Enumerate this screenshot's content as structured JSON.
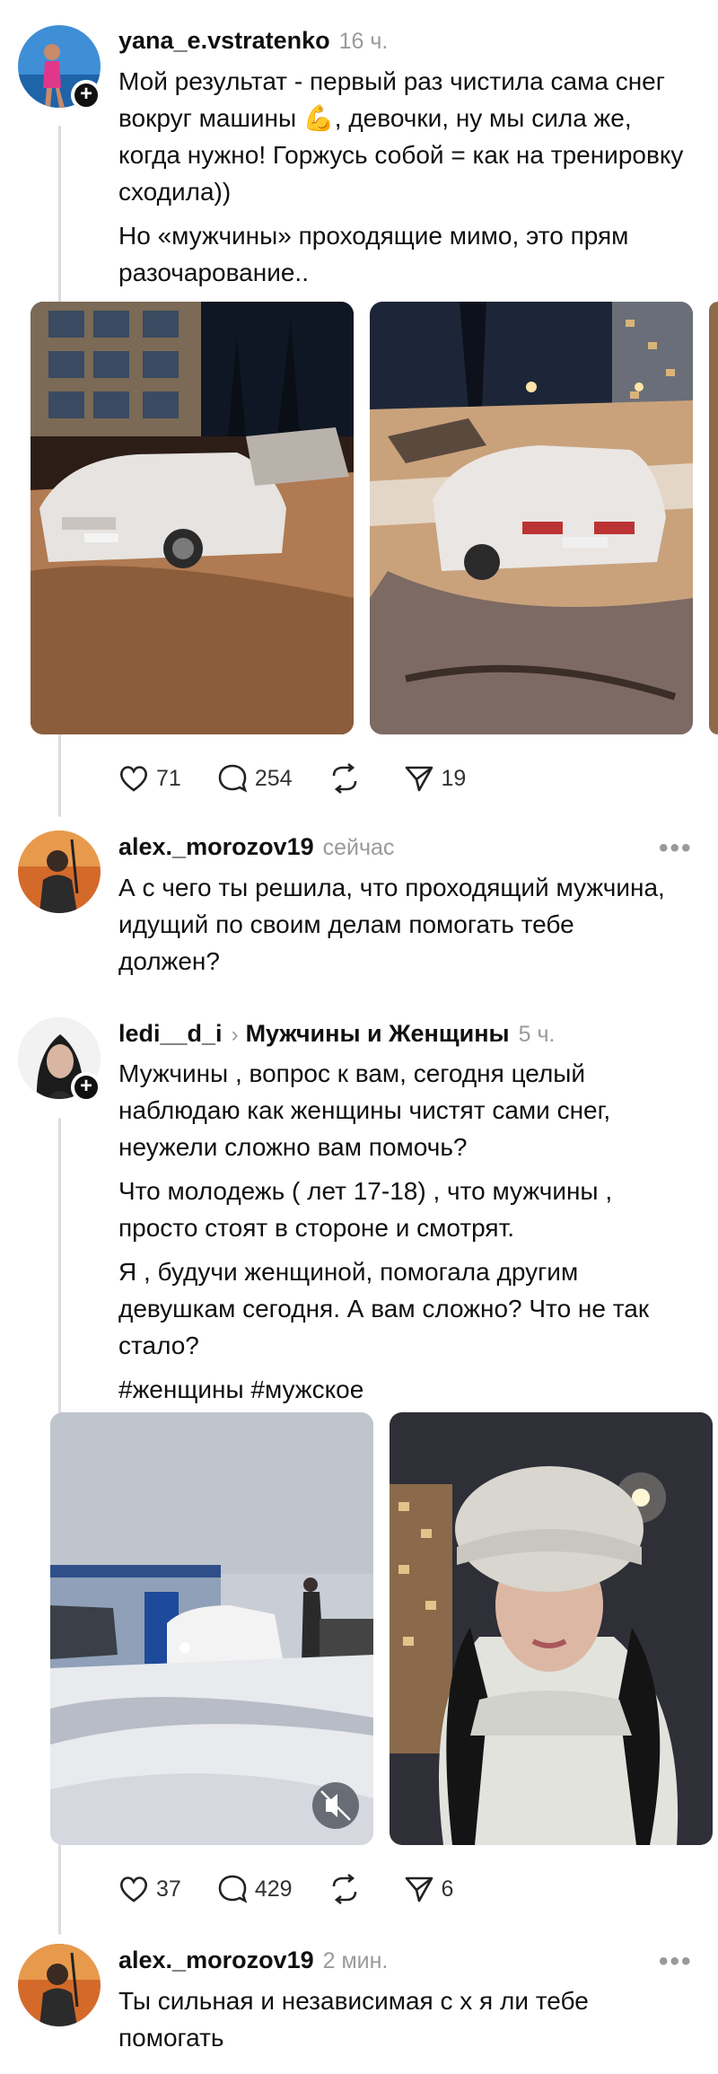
{
  "post1": {
    "username": "yana_e.vstratenko",
    "time": "16 ч.",
    "paragraphs": [
      "Мой результат - первый раз чистила сама снег вокруг машины 💪, девочки, ну мы сила же, когда нужно! Горжусь собой = как на тренировку сходила))",
      "Но «мужчины» проходящие мимо, это прям разочарование.."
    ],
    "likes": "71",
    "comments": "254",
    "shares": "19"
  },
  "reply1": {
    "username": "alex._morozov19",
    "time": "сейчас",
    "text": "А с чего ты решила, что проходящий мужчина, идущий по своим делам помогать тебе должен?"
  },
  "post2": {
    "username": "ledi__d_i",
    "community_arrow": "›",
    "community": "Мужчины и Женщины",
    "time": "5 ч.",
    "paragraphs": [
      "Мужчины , вопрос к вам, сегодня целый наблюдаю как женщины чистят сами снег, неужели сложно вам помочь?",
      "Что молодежь ( лет 17-18) , что мужчины , просто стоят в стороне и смотрят.",
      "Я , будучи женщиной, помогала другим девушкам сегодня. А вам сложно? Что не так стало?",
      "#женщины #мужское"
    ],
    "likes": "37",
    "comments": "429",
    "shares": "6"
  },
  "reply2": {
    "username": "alex._morozov19",
    "time": "2 мин.",
    "text": "Ты сильная и независимая с х  я ли тебе помогать"
  },
  "icons": {
    "plus": "+",
    "more": "•••"
  },
  "colors": {
    "text": "#101010",
    "muted": "#9a9a9a",
    "thread": "#dcdcdc"
  }
}
